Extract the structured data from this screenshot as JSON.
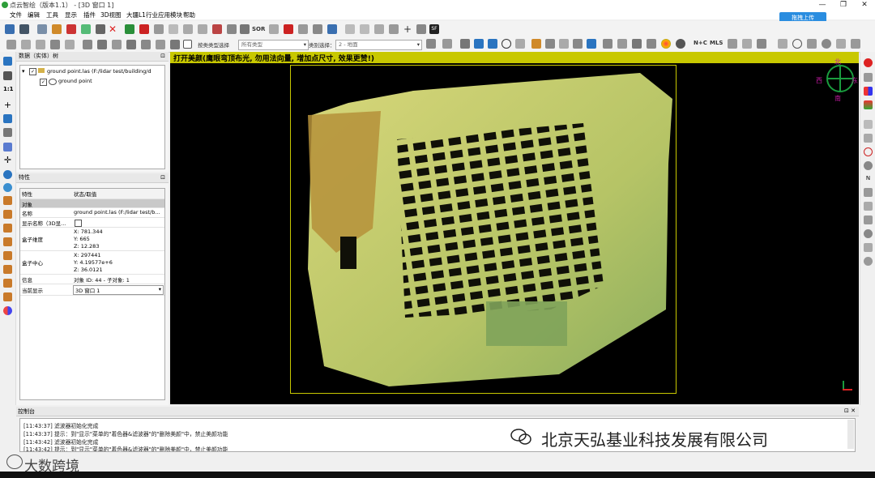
{
  "window": {
    "title": "点云智绘（版本1.1） - [3D 窗口 1]",
    "min": "—",
    "max": "❐",
    "close": "✕"
  },
  "menu": [
    "文件",
    "编辑",
    "工具",
    "显示",
    "插件",
    "3D视图",
    "大疆L1行业应用模块",
    "帮助"
  ],
  "upload_label": "拖拽上传",
  "toolbar2": {
    "combo1_label": "所有类型",
    "combo1_prefix": "按类类型选择",
    "class_select_label": "类别选择：",
    "class_select_value": "2 - 地面",
    "text_sor": "SOR",
    "text_nc": "N+C",
    "text_mls": "MLS"
  },
  "db_panel": {
    "title": "数据（实体）树",
    "tree": [
      {
        "label": "ground point.las (F:/lidar test/building/d",
        "checked": true
      },
      {
        "label": "ground point",
        "checked": true
      }
    ]
  },
  "prop_panel": {
    "title": "特性",
    "header": {
      "k": "特性",
      "v": "状态/取值"
    },
    "section": "对象",
    "rows": [
      {
        "k": "名称",
        "v": [
          "ground point.las (F:/lidar test/b..."
        ]
      },
      {
        "k": "显示名称（3D显...",
        "v": [
          ""
        ]
      },
      {
        "k": "盒子维度",
        "v": [
          "X: 781.344",
          "Y: 665",
          "Z: 12.283"
        ]
      },
      {
        "k": "盒子中心",
        "v": [
          "X: 297441",
          "Y: 4.19577e+6",
          "Z: 36.0121"
        ]
      },
      {
        "k": "信息",
        "v": [
          "对象 ID: 44 - 子对象: 1"
        ]
      },
      {
        "k": "当前显示",
        "v": [
          "3D 窗口 1"
        ]
      }
    ]
  },
  "viewport": {
    "banner": "打开美颜(鹰眼弯顶布光, 勿用法向量, 增加点尺寸, 效果更赞!)",
    "compass": {
      "n": "北",
      "s": "南",
      "e": "东",
      "w": "西"
    },
    "colors": {
      "banner": "#c8c800",
      "frame": "#c8c800",
      "compass": "#1a9c3e",
      "dir": "#c01aa0"
    }
  },
  "console": {
    "title": "控制台",
    "lines": [
      "[11:43:37] 滤波器初始化完成",
      "[11:43:37] 提示：到\"显示\"菜单的\"着色器&滤波器\"的\"删除美颜\"中，禁止美颜功能",
      "[11:43:42] 滤波器初始化完成",
      "[11:43:42] 提示：到\"显示\"菜单的\"着色器&滤波器\"的\"删除美颜\"中，禁止美颜功能"
    ]
  },
  "watermark": {
    "company": "北京天弘基业科技发展有限公司",
    "brand": "大数跨境"
  }
}
